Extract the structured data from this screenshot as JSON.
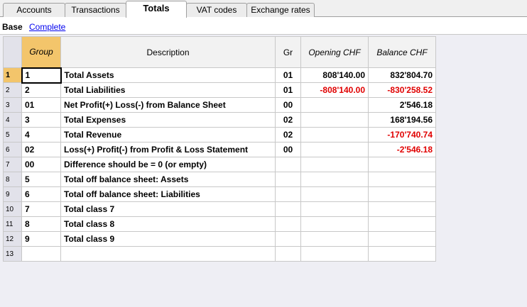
{
  "tabs": [
    {
      "label": "Accounts"
    },
    {
      "label": "Transactions"
    },
    {
      "label": "Totals"
    },
    {
      "label": "VAT codes"
    },
    {
      "label": "Exchange rates"
    }
  ],
  "views": {
    "base": "Base",
    "complete": "Complete"
  },
  "columns": {
    "group": "Group",
    "description": "Description",
    "gr": "Gr",
    "opening": "Opening CHF",
    "balance": "Balance CHF"
  },
  "rows": [
    {
      "num": "1",
      "group": "1",
      "description": "Total Assets",
      "gr": "01",
      "opening": "808'140.00",
      "balance": "832'804.70"
    },
    {
      "num": "2",
      "group": "2",
      "description": "Total Liabilities",
      "gr": "01",
      "opening": "-808'140.00",
      "balance": "-830'258.52"
    },
    {
      "num": "3",
      "group": "01",
      "description": "Net Profit(+) Loss(-) from Balance Sheet",
      "gr": "00",
      "opening": "",
      "balance": "2'546.18"
    },
    {
      "num": "4",
      "group": "3",
      "description": "Total Expenses",
      "gr": "02",
      "opening": "",
      "balance": "168'194.56"
    },
    {
      "num": "5",
      "group": "4",
      "description": "Total Revenue",
      "gr": "02",
      "opening": "",
      "balance": "-170'740.74"
    },
    {
      "num": "6",
      "group": "02",
      "description": "Loss(+)  Profit(-) from Profit & Loss Statement",
      "gr": "00",
      "opening": "",
      "balance": "-2'546.18"
    },
    {
      "num": "7",
      "group": "00",
      "description": "Difference should be = 0 (or empty)",
      "gr": "",
      "opening": "",
      "balance": ""
    },
    {
      "num": "8",
      "group": "5",
      "description": "Total off balance sheet: Assets",
      "gr": "",
      "opening": "",
      "balance": ""
    },
    {
      "num": "9",
      "group": "6",
      "description": "Total off balance sheet: Liabilities",
      "gr": "",
      "opening": "",
      "balance": ""
    },
    {
      "num": "10",
      "group": "7",
      "description": "Total class 7",
      "gr": "",
      "opening": "",
      "balance": ""
    },
    {
      "num": "11",
      "group": "8",
      "description": "Total class 8",
      "gr": "",
      "opening": "",
      "balance": ""
    },
    {
      "num": "12",
      "group": "9",
      "description": "Total class 9",
      "gr": "",
      "opening": "",
      "balance": ""
    },
    {
      "num": "13",
      "group": "",
      "description": "",
      "gr": "",
      "opening": "",
      "balance": ""
    }
  ],
  "colors": {
    "negative": "#e00000",
    "selected_header": "#f3c56b"
  }
}
